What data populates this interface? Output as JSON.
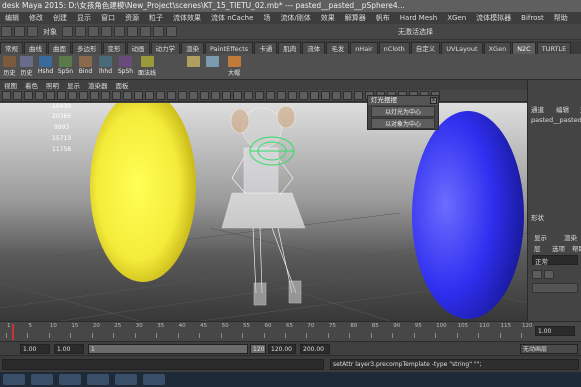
{
  "window": {
    "title": "desk Maya 2015: D:\\女孩角色建模\\New_Project\\scenes\\KT_15_TIETU_02.mb*   ---   pasted__pasted__pSphere4..."
  },
  "menubar": {
    "items": [
      "编辑",
      "修改",
      "创建",
      "显示",
      "窗口",
      "资源",
      "粒子",
      "流体效果",
      "流体 nCache",
      "场",
      "流体/刚体",
      "效果",
      "解算器",
      "帆布",
      "Hard Mesh",
      "XGen",
      "流体模拟器",
      "Bifrost",
      "帮助"
    ]
  },
  "statusline": {
    "mode_label": "对象",
    "search_label": "无激活选择"
  },
  "shelf_tabs": {
    "items": [
      "常规",
      "曲线",
      "曲面",
      "多边形",
      "变形",
      "动画",
      "动力学",
      "渲染",
      "PaintEffects",
      "卡通",
      "肌肉",
      "流体",
      "毛发",
      "nHair",
      "nCloth",
      "自定义",
      "UVLayout",
      "XGen",
      "N2C",
      "TURTLE"
    ],
    "active_index": 18
  },
  "shelf": {
    "buttons": [
      "历史",
      "历史",
      "Hshd",
      "SpSn",
      "Bind",
      "lhhd",
      "SpSh",
      "面法线",
      "",
      "",
      "大帽",
      "",
      ""
    ]
  },
  "viewport_menu": {
    "items": [
      "视图",
      "着色",
      "照明",
      "显示",
      "渲染器",
      "面板"
    ]
  },
  "hud": {
    "values": [
      "10439",
      "20365",
      "9993",
      "15713",
      "11758"
    ]
  },
  "popup": {
    "title": "灯光摆摆",
    "close_label": "x",
    "buttons": [
      "以灯光为中心",
      "以对象为中心"
    ]
  },
  "channel_box": {
    "menu_left": "通道",
    "menu_mid": "编辑",
    "menu_right": "对象",
    "object_name": "pasted__pasted__",
    "shapes_label": "形状",
    "layer_tabs": [
      "显示",
      "渲染"
    ],
    "layer_menu": [
      "层",
      "选项",
      "帮助"
    ],
    "layer_mode": "正常"
  },
  "timeline": {
    "ticks": [
      "1",
      "5",
      "10",
      "15",
      "20",
      "25",
      "30",
      "35",
      "40",
      "45",
      "50",
      "55",
      "60",
      "65",
      "70",
      "75",
      "80",
      "85",
      "90",
      "95",
      "100",
      "105",
      "110",
      "115",
      "120"
    ],
    "current_frame": "1.00"
  },
  "range": {
    "start": "1.00",
    "start2": "1.00",
    "mid": "1",
    "end": "120",
    "end_val": "120.00",
    "max": "200.00",
    "anim_layer": "无动画层"
  },
  "command": {
    "text": "setAttr layer3.precompTemplate -type \"string\" \"\";"
  }
}
